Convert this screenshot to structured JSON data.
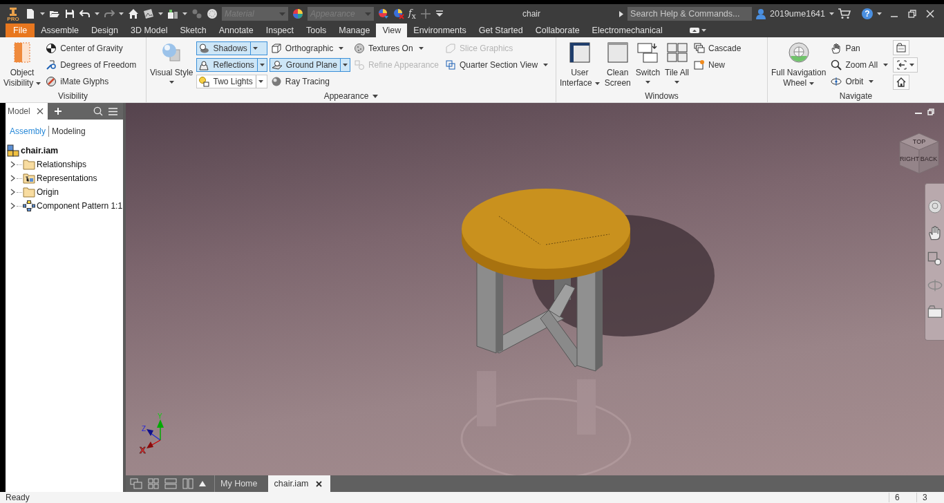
{
  "title_bar": {
    "logo": "PRO",
    "material": {
      "value": "Material"
    },
    "appearance": {
      "value": "Appearance"
    },
    "formula": "*f*$_{x}$",
    "title": "chair",
    "search": {
      "placeholder": "Search Help & Commands..."
    },
    "user": "2019ume1641",
    "help": "?"
  },
  "tabs": [
    {
      "label": "File",
      "kind": "file",
      "selected": false
    },
    {
      "label": "Assemble",
      "kind": "tab",
      "selected": false
    },
    {
      "label": "Design",
      "kind": "tab",
      "selected": false
    },
    {
      "label": "3D Model",
      "kind": "tab",
      "selected": false
    },
    {
      "label": "Sketch",
      "kind": "tab",
      "selected": false
    },
    {
      "label": "Annotate",
      "kind": "tab",
      "selected": false
    },
    {
      "label": "Inspect",
      "kind": "tab",
      "selected": false
    },
    {
      "label": "Tools",
      "kind": "tab",
      "selected": false
    },
    {
      "label": "Manage",
      "kind": "tab",
      "selected": false
    },
    {
      "label": "View",
      "kind": "tab",
      "selected": true
    },
    {
      "label": "Environments",
      "kind": "tab",
      "selected": false
    },
    {
      "label": "Get Started",
      "kind": "tab",
      "selected": false
    },
    {
      "label": "Collaborate",
      "kind": "tab",
      "selected": false
    },
    {
      "label": "Electromechanical",
      "kind": "tab",
      "selected": false
    }
  ],
  "ribbon": {
    "panels": [
      {
        "title": "Visibility",
        "menu": false,
        "columns": [
          {
            "kind": "large",
            "tools": [
              {
                "lines": [
                  "Object",
                  "Visibility"
                ],
                "arrow_beside": true,
                "arrow_below": false
              }
            ]
          },
          {
            "kind": "small",
            "tools": [
              {
                "label": "Center of Gravity",
                "split": false,
                "arrow": false,
                "toggled": false,
                "disabled": false
              },
              {
                "label": "Degrees of Freedom",
                "split": false,
                "arrow": false,
                "toggled": false,
                "disabled": false
              },
              {
                "label": "iMate Glyphs",
                "split": false,
                "arrow": false,
                "toggled": false,
                "disabled": false
              }
            ]
          }
        ]
      },
      {
        "title": "Appearance",
        "menu": true,
        "columns": [
          {
            "kind": "large",
            "tools": [
              {
                "lines": [
                  "Visual Style"
                ],
                "arrow_beside": false,
                "arrow_below": true
              }
            ]
          },
          {
            "kind": "small",
            "tools": [
              {
                "label": "Shadows",
                "split": true,
                "arrow": false,
                "toggled": true,
                "disabled": false
              },
              {
                "label": "Reflections",
                "split": true,
                "arrow": false,
                "toggled": true,
                "disabled": false
              },
              {
                "label": "Two Lights",
                "split": true,
                "arrow": false,
                "toggled": false,
                "disabled": false
              }
            ]
          },
          {
            "kind": "small",
            "tools": [
              {
                "label": "Orthographic",
                "split": false,
                "arrow": true,
                "toggled": false,
                "disabled": false
              },
              {
                "label": "Ground Plane",
                "split": true,
                "arrow": false,
                "toggled": true,
                "disabled": false
              },
              {
                "label": "Ray Tracing",
                "split": false,
                "arrow": false,
                "toggled": false,
                "disabled": false
              }
            ]
          },
          {
            "kind": "small",
            "tools": [
              {
                "label": "Textures On",
                "split": false,
                "arrow": true,
                "toggled": false,
                "disabled": false
              },
              {
                "label": "Refine Appearance",
                "split": false,
                "arrow": false,
                "toggled": false,
                "disabled": true
              }
            ]
          },
          {
            "kind": "small",
            "tools": [
              {
                "label": "Slice Graphics",
                "split": false,
                "arrow": false,
                "toggled": false,
                "disabled": true
              },
              {
                "label": "Quarter Section View",
                "split": false,
                "arrow": true,
                "toggled": false,
                "disabled": false
              }
            ]
          }
        ]
      },
      {
        "title": "Windows",
        "menu": false,
        "columns": [
          {
            "kind": "large",
            "tools": [
              {
                "lines": [
                  "User",
                  "Interface"
                ],
                "arrow_beside": true,
                "arrow_below": false
              }
            ]
          },
          {
            "kind": "large",
            "tools": [
              {
                "lines": [
                  "Clean",
                  "Screen"
                ],
                "arrow_beside": false,
                "arrow_below": false
              }
            ]
          },
          {
            "kind": "large",
            "tools": [
              {
                "lines": [
                  "Switch"
                ],
                "arrow_beside": false,
                "arrow_below": true
              }
            ]
          },
          {
            "kind": "large",
            "tools": [
              {
                "lines": [
                  "Tile All"
                ],
                "arrow_beside": false,
                "arrow_below": true
              }
            ]
          },
          {
            "kind": "small",
            "tools": [
              {
                "label": "Cascade",
                "split": false,
                "arrow": false,
                "toggled": false,
                "disabled": false
              },
              {
                "label": "New",
                "split": false,
                "arrow": false,
                "toggled": false,
                "disabled": false
              }
            ]
          }
        ]
      },
      {
        "title": "Navigate",
        "menu": false,
        "columns": [
          {
            "kind": "large",
            "tools": [
              {
                "lines": [
                  "Full Navigation",
                  "Wheel"
                ],
                "arrow_beside": true,
                "arrow_below": false
              }
            ]
          },
          {
            "kind": "small",
            "tools": [
              {
                "label": "Pan",
                "split": false,
                "arrow": false,
                "toggled": false,
                "disabled": false
              },
              {
                "label": "Zoom All",
                "split": false,
                "arrow": true,
                "toggled": false,
                "disabled": false
              },
              {
                "label": "Orbit",
                "split": false,
                "arrow": true,
                "toggled": false,
                "disabled": false
              }
            ]
          },
          {
            "kind": "icons",
            "tools": [
              {
                "split": false
              },
              {
                "split": true
              },
              {
                "split": false
              }
            ]
          }
        ]
      }
    ]
  },
  "browser": {
    "tab": "Model",
    "views": [
      {
        "label": "Assembly",
        "selected": true
      },
      {
        "label": "Modeling",
        "selected": false
      }
    ],
    "tree": {
      "label": "chair.iam",
      "children": [
        {
          "label": "Relationships",
          "expanded": false
        },
        {
          "label": "Representations",
          "expanded": false
        },
        {
          "label": "Origin",
          "expanded": false
        },
        {
          "label": "Component Pattern 1:1",
          "expanded": false
        }
      ]
    }
  },
  "viewport": {
    "view_cube": {
      "faces": [
        "TOP",
        "RIGHT",
        "BACK"
      ]
    },
    "axes": [
      "X",
      "Y",
      "Z"
    ]
  },
  "document_tabs": [
    {
      "label": "My Home",
      "selected": false
    },
    {
      "label": "chair.iam",
      "selected": true
    }
  ],
  "status_bar": {
    "message": "Ready",
    "cells": [
      "6",
      "3"
    ]
  }
}
